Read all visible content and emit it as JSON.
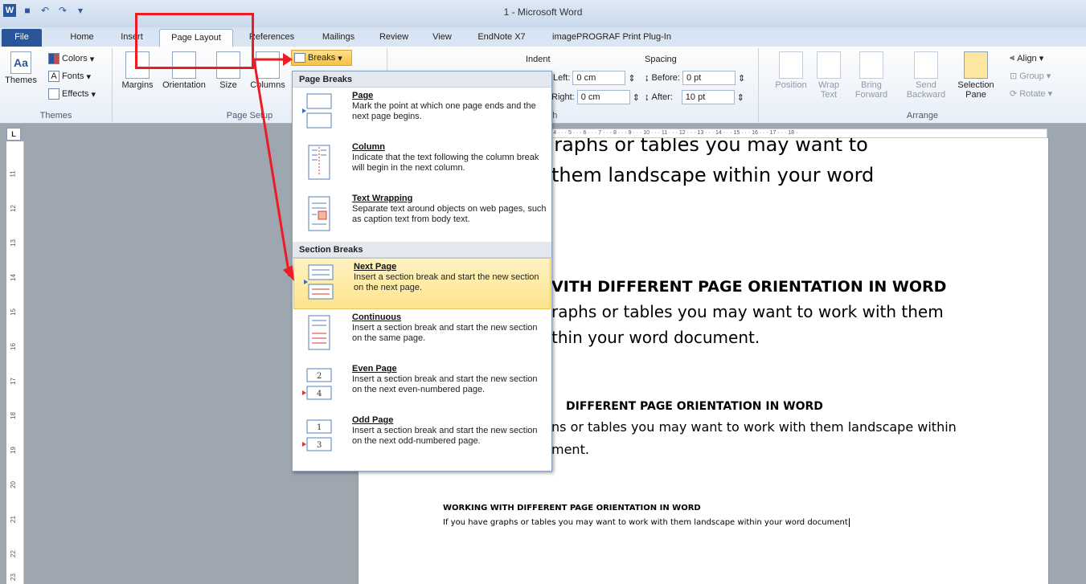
{
  "window": {
    "title": "1 - Microsoft Word"
  },
  "tabs": [
    "File",
    "Home",
    "Insert",
    "Page Layout",
    "References",
    "Mailings",
    "Review",
    "View",
    "EndNote X7",
    "imagePROGRAF Print Plug-In"
  ],
  "ribbon": {
    "themes": {
      "themes_label": "Themes",
      "colors": "Colors",
      "fonts": "Fonts",
      "effects": "Effects",
      "group": "Themes"
    },
    "page_setup": {
      "margins": "Margins",
      "orientation": "Orientation",
      "size": "Size",
      "columns": "Columns",
      "breaks": "Breaks",
      "group": "Page Setup"
    },
    "paragraph": {
      "indent": "Indent",
      "spacing": "Spacing",
      "left_label": "Left:",
      "left_value": "0 cm",
      "right_label": "Right:",
      "right_value": "0 cm",
      "before_label": "Before:",
      "before_value": "0 pt",
      "after_label": "After:",
      "after_value": "10 pt",
      "group": "Paragraph"
    },
    "arrange": {
      "position": "Position",
      "wrap": "Wrap",
      "wrap2": "Text",
      "bring": "Bring",
      "bring2": "Forward",
      "send": "Send",
      "send2": "Backward",
      "selection": "Selection",
      "selection2": "Pane",
      "align": "Align",
      "group_btn": "Group",
      "rotate": "Rotate",
      "group": "Arrange"
    }
  },
  "breaks_menu": {
    "page_breaks_header": "Page Breaks",
    "section_breaks_header": "Section Breaks",
    "page_items": [
      {
        "title": "Page",
        "desc": "Mark the point at which one page ends and the next page begins."
      },
      {
        "title": "Column",
        "desc": "Indicate that the text following the column break will begin in the next column."
      },
      {
        "title": "Text Wrapping",
        "desc": "Separate text around objects on web pages, such as caption text from body text."
      }
    ],
    "section_items": [
      {
        "title": "Next Page",
        "desc": "Insert a section break and start the new section on the next page."
      },
      {
        "title": "Continuous",
        "desc": "Insert a section break and start the new section on the same page."
      },
      {
        "title": "Even Page",
        "desc": "Insert a section break and start the new section on the next even-numbered page."
      },
      {
        "title": "Odd Page",
        "desc": "Insert a section break and start the new section on the next odd-numbered page."
      }
    ]
  },
  "document": {
    "line1": "graphs or tables you may want to",
    "line2": "them landscape within your word",
    "heading2": "VITH DIFFERENT PAGE ORIENTATION IN WORD",
    "line3": "raphs or tables you may want to work with them",
    "line4": "thin your word document.",
    "heading3": "DIFFERENT PAGE ORIENTATION IN WORD",
    "line5": "ns or tables you may want to work with them landscape within",
    "line6": "ment.",
    "heading4": "WORKING WITH DIFFERENT PAGE ORIENTATION IN WORD",
    "line7": "If you have graphs or tables you may want to work with them landscape within your word document"
  },
  "ruler": {
    "top": "· 4 · · · 5 · · · 6 · · · 7 · · · 8 · · · 9 · · · 10 · · · 11 · · · 12 · · · 13 · · · 14 · · · 15 · · · 16 · · · 17 · · · 18 ·",
    "corner": "L",
    "left_numbers": [
      "11",
      "12",
      "13",
      "14",
      "15",
      "16",
      "17",
      "18",
      "19",
      "20",
      "21",
      "22",
      "23"
    ]
  },
  "colors": {
    "accent": "#2b579a",
    "highlight": "#fde48c",
    "annotation": "#ec1c24"
  }
}
